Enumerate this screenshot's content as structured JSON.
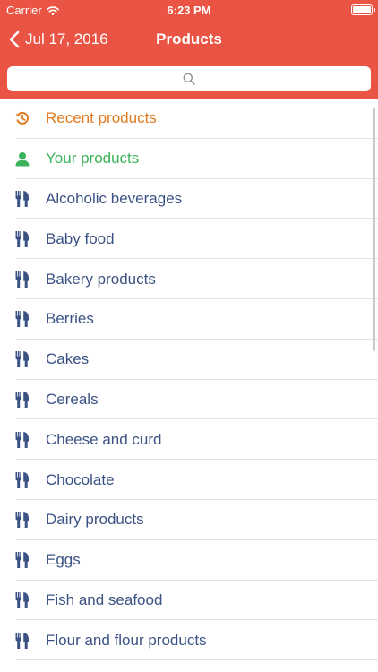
{
  "status_bar": {
    "carrier": "Carrier",
    "time": "6:23 PM",
    "battery_level": 1.0
  },
  "nav": {
    "back_label": "Jul 17, 2016",
    "title": "Products"
  },
  "search": {
    "placeholder": ""
  },
  "colors": {
    "header": "#ea5444",
    "recent": "#e07b22",
    "yours": "#3cb35a",
    "category": "#3b5384",
    "separator": "#e2e2e6"
  },
  "list": {
    "special": [
      {
        "label": "Recent products",
        "icon": "history-icon"
      },
      {
        "label": "Your products",
        "icon": "user-icon"
      }
    ],
    "categories": [
      {
        "label": "Alcoholic beverages",
        "icon": "fork-knife-icon"
      },
      {
        "label": "Baby food",
        "icon": "fork-knife-icon"
      },
      {
        "label": "Bakery products",
        "icon": "fork-knife-icon"
      },
      {
        "label": "Berries",
        "icon": "fork-knife-icon"
      },
      {
        "label": "Cakes",
        "icon": "fork-knife-icon"
      },
      {
        "label": "Cereals",
        "icon": "fork-knife-icon"
      },
      {
        "label": "Cheese and curd",
        "icon": "fork-knife-icon"
      },
      {
        "label": "Chocolate",
        "icon": "fork-knife-icon"
      },
      {
        "label": "Dairy products",
        "icon": "fork-knife-icon"
      },
      {
        "label": "Eggs",
        "icon": "fork-knife-icon"
      },
      {
        "label": "Fish and seafood",
        "icon": "fork-knife-icon"
      },
      {
        "label": "Flour and flour products",
        "icon": "fork-knife-icon"
      }
    ]
  }
}
